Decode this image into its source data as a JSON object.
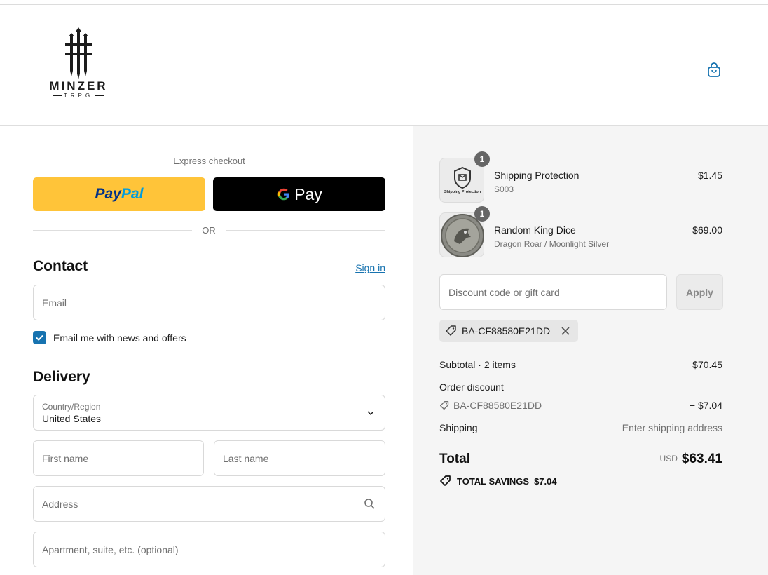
{
  "header": {
    "logo_text": "MINZER",
    "logo_sub": "TRPG",
    "cart_icon": "shopping-bag-icon"
  },
  "express": {
    "label": "Express checkout",
    "paypal_a": "Pay",
    "paypal_b": "Pal",
    "gpay_label": "Pay",
    "or": "OR"
  },
  "contact": {
    "heading": "Contact",
    "signin": "Sign in",
    "email_placeholder": "Email",
    "newsletter_label": "Email me with news and offers",
    "newsletter_checked": true
  },
  "delivery": {
    "heading": "Delivery",
    "country_label": "Country/Region",
    "country_value": "United States",
    "first_name_placeholder": "First name",
    "last_name_placeholder": "Last name",
    "address_placeholder": "Address",
    "apartment_placeholder": "Apartment, suite, etc. (optional)"
  },
  "summary": {
    "items": [
      {
        "name": "Shipping Protection",
        "variant": "S003",
        "price": "$1.45",
        "qty": "1",
        "thumb_text": "Shipping Protection"
      },
      {
        "name": "Random King Dice",
        "variant": "Dragon Roar / Moonlight Silver",
        "price": "$69.00",
        "qty": "1"
      }
    ],
    "discount_placeholder": "Discount code or gift card",
    "apply_label": "Apply",
    "applied_code": "BA-CF88580E21DD",
    "subtotal_label": "Subtotal · 2 items",
    "subtotal_value": "$70.45",
    "order_discount_label": "Order discount",
    "order_discount_code": "BA-CF88580E21DD",
    "order_discount_value": "− $7.04",
    "shipping_label": "Shipping",
    "shipping_value": "Enter shipping address",
    "total_label": "Total",
    "total_currency": "USD",
    "total_value": "$63.41",
    "savings_label": "TOTAL SAVINGS",
    "savings_value": "$7.04"
  },
  "colors": {
    "paypal_yellow": "#ffc439",
    "link_blue": "#1773b0",
    "summary_bg": "#f5f5f5"
  }
}
